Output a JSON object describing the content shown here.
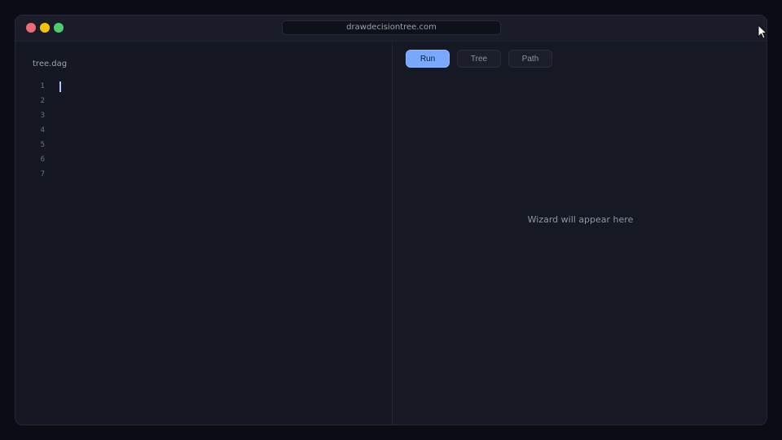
{
  "browser": {
    "url": "drawdecisiontree.com"
  },
  "editor": {
    "filename": "tree.dag",
    "line_numbers": [
      "1",
      "2",
      "3",
      "4",
      "5",
      "6",
      "7"
    ]
  },
  "preview": {
    "tabs": [
      {
        "label": "Run",
        "active": true
      },
      {
        "label": "Tree",
        "active": false
      },
      {
        "label": "Path",
        "active": false
      }
    ],
    "placeholder": "Wizard will appear here"
  },
  "colors": {
    "accent": "#78a9ff",
    "background": "#141722",
    "close_dot": "#ef6b73",
    "minimize_dot": "#f5c400",
    "maximize_dot": "#4ccd6a"
  },
  "icons": [
    "close-window-icon",
    "minimize-window-icon",
    "maximize-window-icon",
    "mouse-pointer-icon"
  ]
}
